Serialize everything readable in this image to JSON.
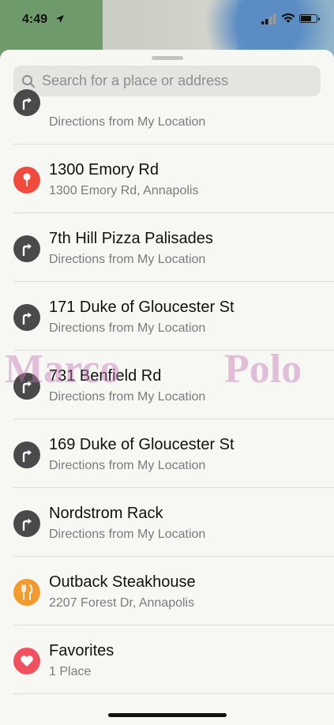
{
  "status_bar": {
    "time": "4:49"
  },
  "search": {
    "placeholder": "Search for a place or address"
  },
  "list": [
    {
      "title": "",
      "subtitle": "Directions from My Location",
      "icon": "directions-icon",
      "color": "#4a4a4c"
    },
    {
      "title": "1300 Emory Rd",
      "subtitle": "1300 Emory Rd, Annapolis",
      "icon": "pin-icon",
      "color": "#ef4b3f"
    },
    {
      "title": "7th Hill Pizza Palisades",
      "subtitle": "Directions from My Location",
      "icon": "directions-icon",
      "color": "#4a4a4c"
    },
    {
      "title": "171 Duke of Gloucester St",
      "subtitle": "Directions from My Location",
      "icon": "directions-icon",
      "color": "#4a4a4c"
    },
    {
      "title": "731 Benfield Rd",
      "subtitle": "Directions from My Location",
      "icon": "directions-icon",
      "color": "#4a4a4c"
    },
    {
      "title": "169 Duke of Gloucester St",
      "subtitle": "Directions from My Location",
      "icon": "directions-icon",
      "color": "#4a4a4c"
    },
    {
      "title": "Nordstrom Rack",
      "subtitle": "Directions from My Location",
      "icon": "directions-icon",
      "color": "#4a4a4c"
    },
    {
      "title": "Outback Steakhouse",
      "subtitle": "2207 Forest Dr, Annapolis",
      "icon": "fork-knife-icon",
      "color": "#f39a2e"
    },
    {
      "title": "Favorites",
      "subtitle": "1 Place",
      "icon": "heart-icon",
      "color": "#f0505f"
    }
  ],
  "watermark": {
    "left": "Marco",
    "right": "Polo"
  }
}
